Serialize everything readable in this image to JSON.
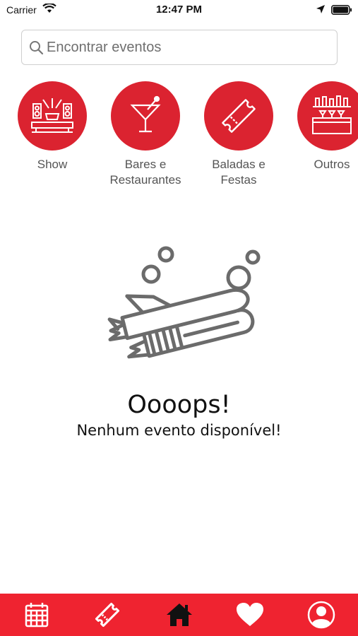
{
  "status_bar": {
    "carrier": "Carrier",
    "time": "12:47 PM"
  },
  "search": {
    "placeholder": "Encontrar eventos",
    "value": ""
  },
  "categories": [
    {
      "label": "Show",
      "icon": "stage-icon"
    },
    {
      "label": "Bares e Restaurantes",
      "icon": "cocktail-icon"
    },
    {
      "label": "Baladas e Festas",
      "icon": "ticket-icon"
    },
    {
      "label": "Outros",
      "icon": "bar-counter-icon"
    }
  ],
  "empty_state": {
    "title": "Oooops!",
    "message": "Nenhum evento disponível!"
  },
  "bottom_nav": {
    "items": [
      {
        "icon": "calendar-icon"
      },
      {
        "icon": "ticket-icon"
      },
      {
        "icon": "home-icon",
        "active": true
      },
      {
        "icon": "heart-icon"
      },
      {
        "icon": "profile-icon"
      }
    ]
  },
  "colors": {
    "accent": "#db2330",
    "nav_background": "#ef2330",
    "active_icon": "#111111",
    "inactive_icon": "#ffffff"
  }
}
